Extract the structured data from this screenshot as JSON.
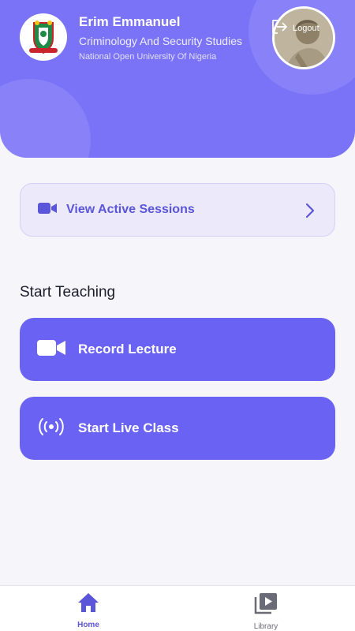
{
  "header": {
    "name": "Erim Emmanuel",
    "department": "Criminology And Security Studies",
    "university": "National Open University Of Nigeria",
    "logout_label": "Logout",
    "icons": {
      "logo": "university-crest-icon",
      "avatar": "profile-photo",
      "logout": "logout-icon"
    }
  },
  "sessions": {
    "label": "View Active Sessions",
    "icons": {
      "leading": "video-camera-icon",
      "trailing": "chevron-right-icon"
    }
  },
  "teaching": {
    "title": "Start Teaching",
    "record_label": "Record Lecture",
    "live_label": "Start Live Class",
    "icons": {
      "record": "video-camera-icon",
      "live": "broadcast-icon"
    }
  },
  "nav": {
    "home_label": "Home",
    "library_label": "Library",
    "active": "Home",
    "icons": {
      "home": "home-icon",
      "library": "video-library-icon"
    }
  },
  "colors": {
    "accent": "#6a62f3",
    "header": "#7b73f7",
    "background": "#f5f5fa",
    "session_card": "#ece9fb",
    "active_nav": "#5b55d9"
  }
}
